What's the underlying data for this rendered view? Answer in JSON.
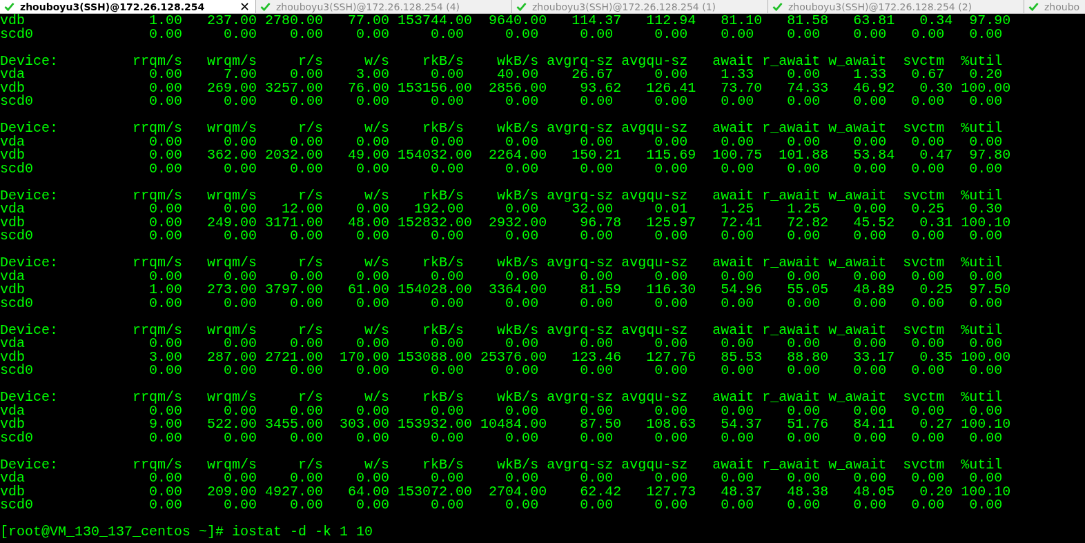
{
  "tabs": [
    {
      "label": "zhouboyu3(SSH)@172.26.128.254",
      "selected": true,
      "connected": true
    },
    {
      "label": "zhouboyu3(SSH)@172.26.128.254 (4)",
      "selected": false,
      "connected": true
    },
    {
      "label": "zhouboyu3(SSH)@172.26.128.254 (1)",
      "selected": false,
      "connected": true
    },
    {
      "label": "zhouboyu3(SSH)@172.26.128.254 (2)",
      "selected": false,
      "connected": true
    },
    {
      "label": "zhoubo",
      "selected": false,
      "connected": true
    }
  ],
  "terminal": {
    "blocks": [
      {
        "rows": [
          {
            "device": "vdb",
            "values": [
              "1.00",
              "237.00",
              "2780.00",
              "77.00",
              "153744.00",
              "9640.00",
              "114.37",
              "112.94",
              "81.10",
              "81.58",
              "63.81",
              "0.34",
              "97.90"
            ]
          },
          {
            "device": "scd0",
            "values": [
              "0.00",
              "0.00",
              "0.00",
              "0.00",
              "0.00",
              "0.00",
              "0.00",
              "0.00",
              "0.00",
              "0.00",
              "0.00",
              "0.00",
              "0.00"
            ]
          }
        ]
      },
      {
        "header": [
          "Device:",
          "rrqm/s",
          "wrqm/s",
          "r/s",
          "w/s",
          "rkB/s",
          "wkB/s",
          "avgrq-sz",
          "avgqu-sz",
          "await",
          "r_await",
          "w_await",
          "svctm",
          "%util"
        ],
        "rows": [
          {
            "device": "vda",
            "values": [
              "0.00",
              "7.00",
              "0.00",
              "3.00",
              "0.00",
              "40.00",
              "26.67",
              "0.00",
              "1.33",
              "0.00",
              "1.33",
              "0.67",
              "0.20"
            ]
          },
          {
            "device": "vdb",
            "values": [
              "0.00",
              "269.00",
              "3257.00",
              "76.00",
              "153156.00",
              "2856.00",
              "93.62",
              "126.41",
              "73.70",
              "74.33",
              "46.92",
              "0.30",
              "100.00"
            ]
          },
          {
            "device": "scd0",
            "values": [
              "0.00",
              "0.00",
              "0.00",
              "0.00",
              "0.00",
              "0.00",
              "0.00",
              "0.00",
              "0.00",
              "0.00",
              "0.00",
              "0.00",
              "0.00"
            ]
          }
        ]
      },
      {
        "header": [
          "Device:",
          "rrqm/s",
          "wrqm/s",
          "r/s",
          "w/s",
          "rkB/s",
          "wkB/s",
          "avgrq-sz",
          "avgqu-sz",
          "await",
          "r_await",
          "w_await",
          "svctm",
          "%util"
        ],
        "rows": [
          {
            "device": "vda",
            "values": [
              "0.00",
              "0.00",
              "0.00",
              "0.00",
              "0.00",
              "0.00",
              "0.00",
              "0.00",
              "0.00",
              "0.00",
              "0.00",
              "0.00",
              "0.00"
            ]
          },
          {
            "device": "vdb",
            "values": [
              "0.00",
              "362.00",
              "2032.00",
              "49.00",
              "154032.00",
              "2264.00",
              "150.21",
              "115.69",
              "100.75",
              "101.88",
              "53.84",
              "0.47",
              "97.80"
            ]
          },
          {
            "device": "scd0",
            "values": [
              "0.00",
              "0.00",
              "0.00",
              "0.00",
              "0.00",
              "0.00",
              "0.00",
              "0.00",
              "0.00",
              "0.00",
              "0.00",
              "0.00",
              "0.00"
            ]
          }
        ]
      },
      {
        "header": [
          "Device:",
          "rrqm/s",
          "wrqm/s",
          "r/s",
          "w/s",
          "rkB/s",
          "wkB/s",
          "avgrq-sz",
          "avgqu-sz",
          "await",
          "r_await",
          "w_await",
          "svctm",
          "%util"
        ],
        "rows": [
          {
            "device": "vda",
            "values": [
              "0.00",
              "0.00",
              "12.00",
              "0.00",
              "192.00",
              "0.00",
              "32.00",
              "0.01",
              "1.25",
              "1.25",
              "0.00",
              "0.25",
              "0.30"
            ]
          },
          {
            "device": "vdb",
            "values": [
              "0.00",
              "249.00",
              "3171.00",
              "48.00",
              "152832.00",
              "2932.00",
              "96.78",
              "125.97",
              "72.41",
              "72.82",
              "45.52",
              "0.31",
              "100.10"
            ]
          },
          {
            "device": "scd0",
            "values": [
              "0.00",
              "0.00",
              "0.00",
              "0.00",
              "0.00",
              "0.00",
              "0.00",
              "0.00",
              "0.00",
              "0.00",
              "0.00",
              "0.00",
              "0.00"
            ]
          }
        ]
      },
      {
        "header": [
          "Device:",
          "rrqm/s",
          "wrqm/s",
          "r/s",
          "w/s",
          "rkB/s",
          "wkB/s",
          "avgrq-sz",
          "avgqu-sz",
          "await",
          "r_await",
          "w_await",
          "svctm",
          "%util"
        ],
        "rows": [
          {
            "device": "vda",
            "values": [
              "0.00",
              "0.00",
              "0.00",
              "0.00",
              "0.00",
              "0.00",
              "0.00",
              "0.00",
              "0.00",
              "0.00",
              "0.00",
              "0.00",
              "0.00"
            ]
          },
          {
            "device": "vdb",
            "values": [
              "1.00",
              "273.00",
              "3797.00",
              "61.00",
              "154028.00",
              "3364.00",
              "81.59",
              "116.30",
              "54.96",
              "55.05",
              "48.89",
              "0.25",
              "97.50"
            ]
          },
          {
            "device": "scd0",
            "values": [
              "0.00",
              "0.00",
              "0.00",
              "0.00",
              "0.00",
              "0.00",
              "0.00",
              "0.00",
              "0.00",
              "0.00",
              "0.00",
              "0.00",
              "0.00"
            ]
          }
        ]
      },
      {
        "header": [
          "Device:",
          "rrqm/s",
          "wrqm/s",
          "r/s",
          "w/s",
          "rkB/s",
          "wkB/s",
          "avgrq-sz",
          "avgqu-sz",
          "await",
          "r_await",
          "w_await",
          "svctm",
          "%util"
        ],
        "rows": [
          {
            "device": "vda",
            "values": [
              "0.00",
              "0.00",
              "0.00",
              "0.00",
              "0.00",
              "0.00",
              "0.00",
              "0.00",
              "0.00",
              "0.00",
              "0.00",
              "0.00",
              "0.00"
            ]
          },
          {
            "device": "vdb",
            "values": [
              "3.00",
              "287.00",
              "2721.00",
              "170.00",
              "153088.00",
              "25376.00",
              "123.46",
              "127.76",
              "85.53",
              "88.80",
              "33.17",
              "0.35",
              "100.00"
            ]
          },
          {
            "device": "scd0",
            "values": [
              "0.00",
              "0.00",
              "0.00",
              "0.00",
              "0.00",
              "0.00",
              "0.00",
              "0.00",
              "0.00",
              "0.00",
              "0.00",
              "0.00",
              "0.00"
            ]
          }
        ]
      },
      {
        "header": [
          "Device:",
          "rrqm/s",
          "wrqm/s",
          "r/s",
          "w/s",
          "rkB/s",
          "wkB/s",
          "avgrq-sz",
          "avgqu-sz",
          "await",
          "r_await",
          "w_await",
          "svctm",
          "%util"
        ],
        "rows": [
          {
            "device": "vda",
            "values": [
              "0.00",
              "0.00",
              "0.00",
              "0.00",
              "0.00",
              "0.00",
              "0.00",
              "0.00",
              "0.00",
              "0.00",
              "0.00",
              "0.00",
              "0.00"
            ]
          },
          {
            "device": "vdb",
            "values": [
              "9.00",
              "522.00",
              "3455.00",
              "303.00",
              "153932.00",
              "10484.00",
              "87.50",
              "108.63",
              "54.37",
              "51.76",
              "84.11",
              "0.27",
              "100.10"
            ]
          },
          {
            "device": "scd0",
            "values": [
              "0.00",
              "0.00",
              "0.00",
              "0.00",
              "0.00",
              "0.00",
              "0.00",
              "0.00",
              "0.00",
              "0.00",
              "0.00",
              "0.00",
              "0.00"
            ]
          }
        ]
      },
      {
        "header": [
          "Device:",
          "rrqm/s",
          "wrqm/s",
          "r/s",
          "w/s",
          "rkB/s",
          "wkB/s",
          "avgrq-sz",
          "avgqu-sz",
          "await",
          "r_await",
          "w_await",
          "svctm",
          "%util"
        ],
        "rows": [
          {
            "device": "vda",
            "values": [
              "0.00",
              "0.00",
              "0.00",
              "0.00",
              "0.00",
              "0.00",
              "0.00",
              "0.00",
              "0.00",
              "0.00",
              "0.00",
              "0.00",
              "0.00"
            ]
          },
          {
            "device": "vdb",
            "values": [
              "0.00",
              "209.00",
              "4927.00",
              "64.00",
              "153072.00",
              "2704.00",
              "62.42",
              "127.73",
              "48.37",
              "48.38",
              "48.05",
              "0.20",
              "100.10"
            ]
          },
          {
            "device": "scd0",
            "values": [
              "0.00",
              "0.00",
              "0.00",
              "0.00",
              "0.00",
              "0.00",
              "0.00",
              "0.00",
              "0.00",
              "0.00",
              "0.00",
              "0.00",
              "0.00"
            ]
          }
        ]
      }
    ],
    "prompt": "[root@VM_130_137_centos ~]# iostat -d -k 1 10"
  }
}
